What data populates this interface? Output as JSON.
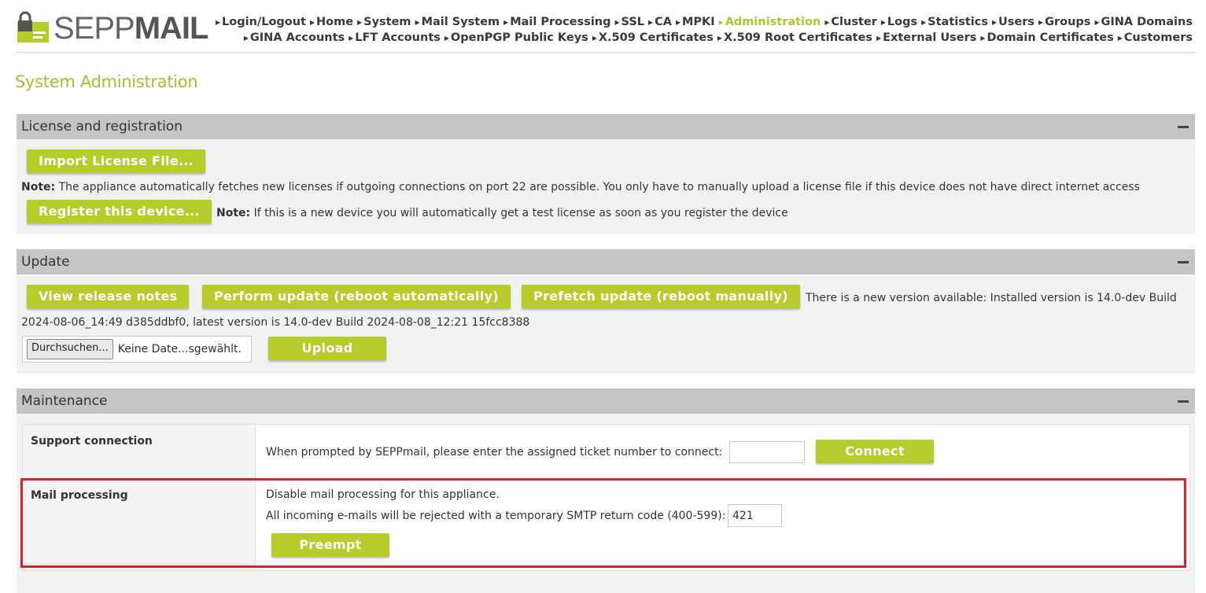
{
  "brand": {
    "name_light": "SEPP",
    "name_bold": "MAIL"
  },
  "nav": {
    "row1": [
      "Login/Logout",
      "Home",
      "System",
      "Mail System",
      "Mail Processing",
      "SSL",
      "CA",
      "MPKI",
      "Administration",
      "Cluster",
      "Logs",
      "Statistics",
      "Users",
      "Groups",
      "GINA Domains"
    ],
    "row2": [
      "GINA Accounts",
      "LFT Accounts",
      "OpenPGP Public Keys",
      "X.509 Certificates",
      "X.509 Root Certificates",
      "External Users",
      "Domain Certificates",
      "Customers"
    ],
    "active": "Administration"
  },
  "page_title": "System Administration",
  "license": {
    "heading": "License and registration",
    "import_button": "Import License File...",
    "note_label": "Note:",
    "note_text": " The appliance automatically fetches new licenses if outgoing connections on port 22 are possible. You only have to manually upload a license file if this device does not have direct internet access",
    "register_button": "Register this device...",
    "register_note_label": "Note:",
    "register_note_text": " If this is a new device you will automatically get a test license as soon as you register the device"
  },
  "update": {
    "heading": "Update",
    "release_notes_button": "View release notes",
    "perform_button": "Perform update (reboot automatically)",
    "prefetch_button": "Prefetch update (reboot manually)",
    "status_line1": "There is a new version available: Installed version is 14.0-dev Build",
    "status_line2": "2024-08-06_14:49 d385ddbf0, latest version is 14.0-dev Build 2024-08-08_12:21 15fcc8388",
    "file_button": "Durchsuchen...",
    "file_name": "Keine Date...sgewählt.",
    "upload_button": "Upload"
  },
  "maintenance": {
    "heading": "Maintenance",
    "support": {
      "label": "Support connection",
      "text": "When prompted by SEPPmail, please enter the assigned ticket number to connect:",
      "ticket_value": "",
      "connect_button": "Connect"
    },
    "mail_processing": {
      "label": "Mail processing",
      "line1": "Disable mail processing for this appliance.",
      "line2": "All incoming e-mails will be rejected with a temporary SMTP return code (400-599):",
      "code_value": "421",
      "preempt_button": "Preempt"
    }
  },
  "colors": {
    "accent": "#b7cc2a",
    "highlight": "#e0202a",
    "section_header": "#c5c5c5"
  }
}
